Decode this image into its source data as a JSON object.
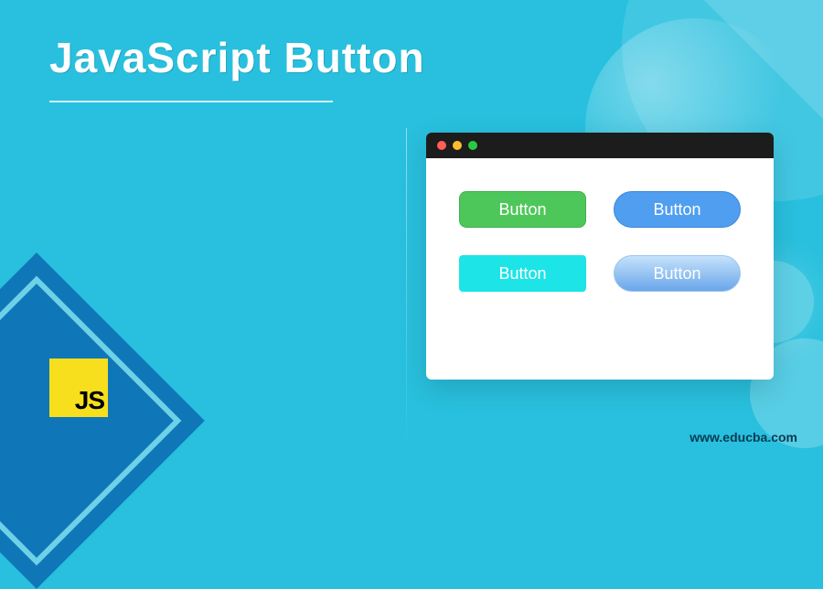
{
  "title": "JavaScript Button",
  "logo": {
    "label": "JS"
  },
  "browser": {
    "buttons": [
      {
        "label": "Button",
        "style": "green-rounded-rect"
      },
      {
        "label": "Button",
        "style": "blue-pill"
      },
      {
        "label": "Button",
        "style": "cyan-rect"
      },
      {
        "label": "Button",
        "style": "blue-gradient-pill"
      }
    ],
    "traffic_lights": [
      "red",
      "yellow",
      "green"
    ]
  },
  "footer": {
    "url": "www.educba.com"
  },
  "colors": {
    "background": "#28c0de",
    "accent_diamond": "#0f77b8",
    "js_logo_bg": "#f7df1e",
    "btn_green": "#4ec75a",
    "btn_blue": "#4f9ef0",
    "btn_cyan": "#1de4e6"
  }
}
